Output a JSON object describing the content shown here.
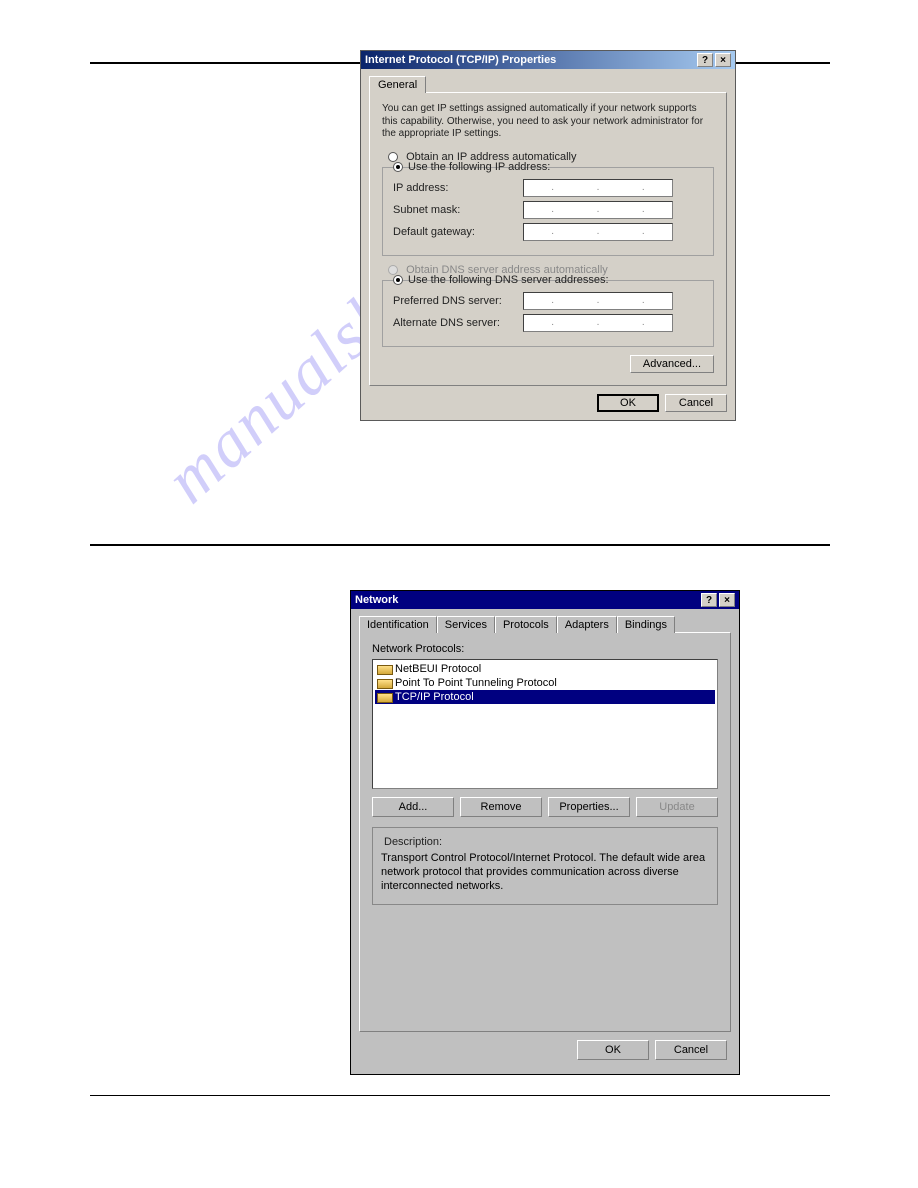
{
  "watermark": "manualshive.com",
  "tcpip_dialog": {
    "title": "Internet Protocol (TCP/IP) Properties",
    "help_glyph": "?",
    "close_glyph": "×",
    "tab_general": "General",
    "help_text": "You can get IP settings assigned automatically if your network supports this capability. Otherwise, you need to ask your network administrator for the appropriate IP settings.",
    "radio_auto_ip": "Obtain an IP address automatically",
    "radio_use_ip": "Use the following IP address:",
    "ip_address_label": "IP address:",
    "subnet_label": "Subnet mask:",
    "gateway_label": "Default gateway:",
    "radio_auto_dns": "Obtain DNS server address automatically",
    "radio_use_dns": "Use the following DNS server addresses:",
    "pref_dns_label": "Preferred DNS server:",
    "alt_dns_label": "Alternate DNS server:",
    "advanced_btn": "Advanced...",
    "ok_btn": "OK",
    "cancel_btn": "Cancel",
    "ip_placeholder_dots": "."
  },
  "network_dialog": {
    "title": "Network",
    "help_glyph": "?",
    "close_glyph": "×",
    "tabs": {
      "identification": "Identification",
      "services": "Services",
      "protocols": "Protocols",
      "adapters": "Adapters",
      "bindings": "Bindings"
    },
    "section_label": "Network Protocols:",
    "protocols": [
      {
        "name": "NetBEUI Protocol",
        "selected": false
      },
      {
        "name": "Point To Point Tunneling Protocol",
        "selected": false
      },
      {
        "name": "TCP/IP Protocol",
        "selected": true
      }
    ],
    "buttons": {
      "add": "Add...",
      "remove": "Remove",
      "properties": "Properties...",
      "update": "Update"
    },
    "description_label": "Description:",
    "description_text": "Transport Control Protocol/Internet Protocol. The default wide area network protocol that provides communication across diverse interconnected networks.",
    "ok_btn": "OK",
    "cancel_btn": "Cancel"
  }
}
